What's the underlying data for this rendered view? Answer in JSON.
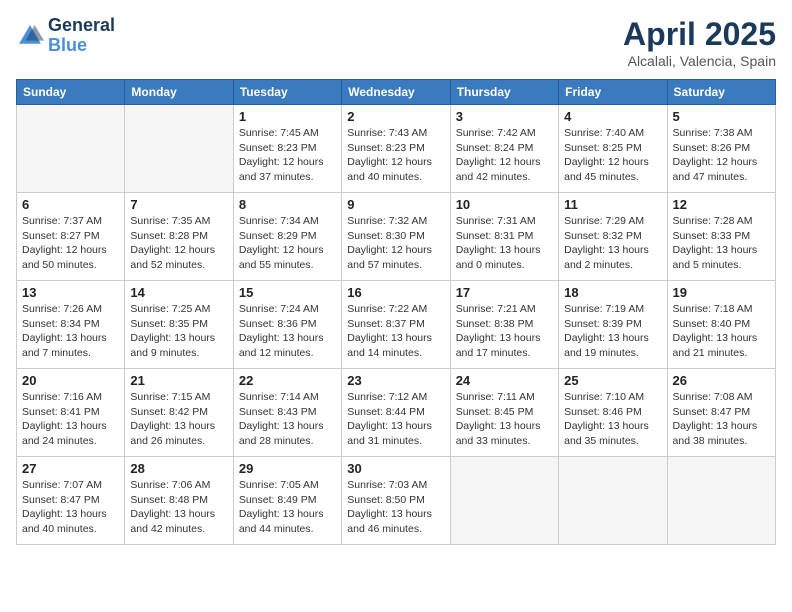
{
  "header": {
    "logo_line1": "General",
    "logo_line2": "Blue",
    "title": "April 2025",
    "location": "Alcalali, Valencia, Spain"
  },
  "weekdays": [
    "Sunday",
    "Monday",
    "Tuesday",
    "Wednesday",
    "Thursday",
    "Friday",
    "Saturday"
  ],
  "weeks": [
    [
      null,
      null,
      {
        "day": 1,
        "sunrise": "7:45 AM",
        "sunset": "8:23 PM",
        "daylight": "12 hours and 37 minutes."
      },
      {
        "day": 2,
        "sunrise": "7:43 AM",
        "sunset": "8:23 PM",
        "daylight": "12 hours and 40 minutes."
      },
      {
        "day": 3,
        "sunrise": "7:42 AM",
        "sunset": "8:24 PM",
        "daylight": "12 hours and 42 minutes."
      },
      {
        "day": 4,
        "sunrise": "7:40 AM",
        "sunset": "8:25 PM",
        "daylight": "12 hours and 45 minutes."
      },
      {
        "day": 5,
        "sunrise": "7:38 AM",
        "sunset": "8:26 PM",
        "daylight": "12 hours and 47 minutes."
      }
    ],
    [
      {
        "day": 6,
        "sunrise": "7:37 AM",
        "sunset": "8:27 PM",
        "daylight": "12 hours and 50 minutes."
      },
      {
        "day": 7,
        "sunrise": "7:35 AM",
        "sunset": "8:28 PM",
        "daylight": "12 hours and 52 minutes."
      },
      {
        "day": 8,
        "sunrise": "7:34 AM",
        "sunset": "8:29 PM",
        "daylight": "12 hours and 55 minutes."
      },
      {
        "day": 9,
        "sunrise": "7:32 AM",
        "sunset": "8:30 PM",
        "daylight": "12 hours and 57 minutes."
      },
      {
        "day": 10,
        "sunrise": "7:31 AM",
        "sunset": "8:31 PM",
        "daylight": "13 hours and 0 minutes."
      },
      {
        "day": 11,
        "sunrise": "7:29 AM",
        "sunset": "8:32 PM",
        "daylight": "13 hours and 2 minutes."
      },
      {
        "day": 12,
        "sunrise": "7:28 AM",
        "sunset": "8:33 PM",
        "daylight": "13 hours and 5 minutes."
      }
    ],
    [
      {
        "day": 13,
        "sunrise": "7:26 AM",
        "sunset": "8:34 PM",
        "daylight": "13 hours and 7 minutes."
      },
      {
        "day": 14,
        "sunrise": "7:25 AM",
        "sunset": "8:35 PM",
        "daylight": "13 hours and 9 minutes."
      },
      {
        "day": 15,
        "sunrise": "7:24 AM",
        "sunset": "8:36 PM",
        "daylight": "13 hours and 12 minutes."
      },
      {
        "day": 16,
        "sunrise": "7:22 AM",
        "sunset": "8:37 PM",
        "daylight": "13 hours and 14 minutes."
      },
      {
        "day": 17,
        "sunrise": "7:21 AM",
        "sunset": "8:38 PM",
        "daylight": "13 hours and 17 minutes."
      },
      {
        "day": 18,
        "sunrise": "7:19 AM",
        "sunset": "8:39 PM",
        "daylight": "13 hours and 19 minutes."
      },
      {
        "day": 19,
        "sunrise": "7:18 AM",
        "sunset": "8:40 PM",
        "daylight": "13 hours and 21 minutes."
      }
    ],
    [
      {
        "day": 20,
        "sunrise": "7:16 AM",
        "sunset": "8:41 PM",
        "daylight": "13 hours and 24 minutes."
      },
      {
        "day": 21,
        "sunrise": "7:15 AM",
        "sunset": "8:42 PM",
        "daylight": "13 hours and 26 minutes."
      },
      {
        "day": 22,
        "sunrise": "7:14 AM",
        "sunset": "8:43 PM",
        "daylight": "13 hours and 28 minutes."
      },
      {
        "day": 23,
        "sunrise": "7:12 AM",
        "sunset": "8:44 PM",
        "daylight": "13 hours and 31 minutes."
      },
      {
        "day": 24,
        "sunrise": "7:11 AM",
        "sunset": "8:45 PM",
        "daylight": "13 hours and 33 minutes."
      },
      {
        "day": 25,
        "sunrise": "7:10 AM",
        "sunset": "8:46 PM",
        "daylight": "13 hours and 35 minutes."
      },
      {
        "day": 26,
        "sunrise": "7:08 AM",
        "sunset": "8:47 PM",
        "daylight": "13 hours and 38 minutes."
      }
    ],
    [
      {
        "day": 27,
        "sunrise": "7:07 AM",
        "sunset": "8:47 PM",
        "daylight": "13 hours and 40 minutes."
      },
      {
        "day": 28,
        "sunrise": "7:06 AM",
        "sunset": "8:48 PM",
        "daylight": "13 hours and 42 minutes."
      },
      {
        "day": 29,
        "sunrise": "7:05 AM",
        "sunset": "8:49 PM",
        "daylight": "13 hours and 44 minutes."
      },
      {
        "day": 30,
        "sunrise": "7:03 AM",
        "sunset": "8:50 PM",
        "daylight": "13 hours and 46 minutes."
      },
      null,
      null,
      null
    ]
  ]
}
